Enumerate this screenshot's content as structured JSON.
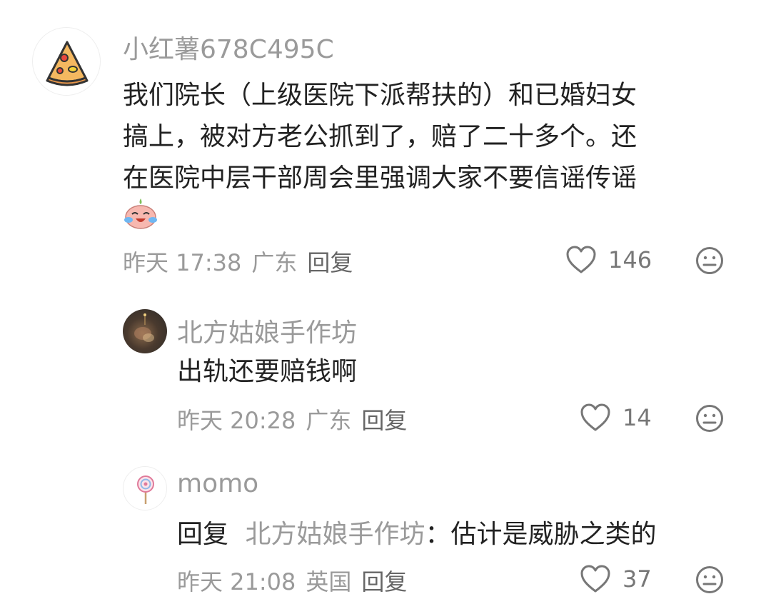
{
  "comments": [
    {
      "username": "小红薯678C495C",
      "text_lines": [
        "我们院长（上级医院下派帮扶的）和已婚妇女",
        "搞上，被对方老公抓到了，赔了二十多个。还",
        "在医院中层干部周会里强调大家不要信谣传谣"
      ],
      "emoji": "crying-laughing-sticker",
      "time": "昨天 17:38",
      "location": "广东",
      "reply_label": "回复",
      "likes": "146"
    },
    {
      "username": "北方姑娘手作坊",
      "text": "出轨还要赔钱啊",
      "time": "昨天 20:28",
      "location": "广东",
      "reply_label": "回复",
      "likes": "14"
    },
    {
      "username": "momo",
      "reply_prefix": "回复",
      "reply_target": "北方姑娘手作坊",
      "colon": "：",
      "text": "估计是威胁之类的",
      "time": "昨天 21:08",
      "location": "英国",
      "reply_label": "回复",
      "likes": "37"
    }
  ],
  "icons": {
    "like": "heart-outline-icon",
    "dislike": "neutral-face-icon"
  },
  "colors": {
    "primary_text": "#222222",
    "secondary_text": "#9a9a9a",
    "icon_gray": "#777777"
  }
}
